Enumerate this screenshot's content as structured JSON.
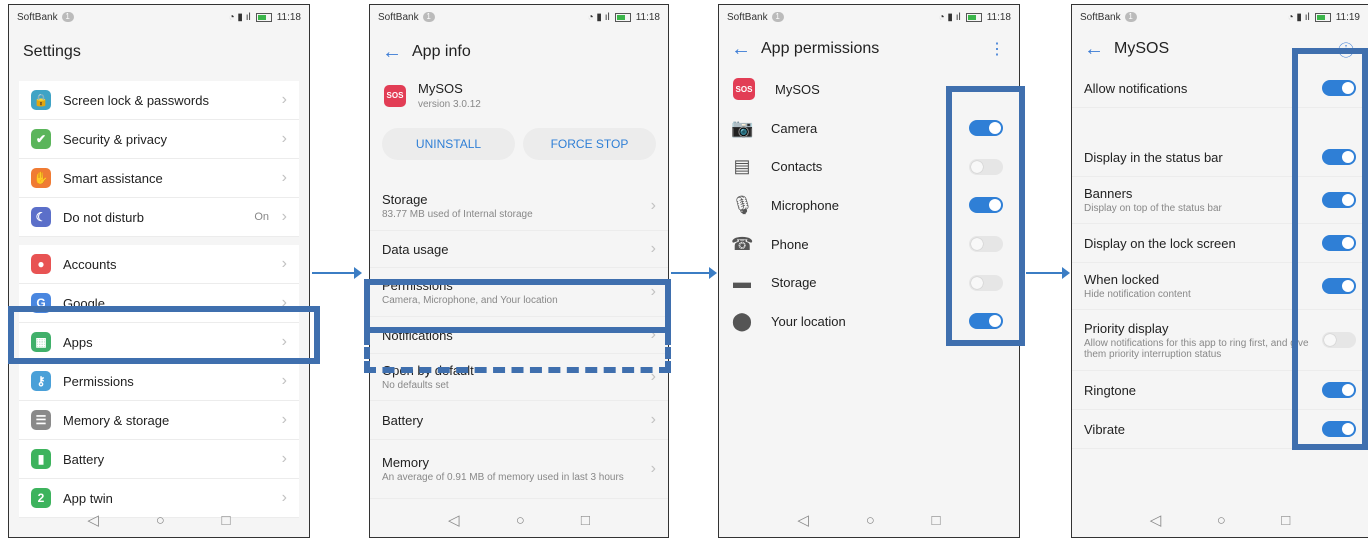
{
  "status": {
    "carrier": "SoftBank",
    "sim": "1",
    "time": "11:18",
    "time4": "11:19"
  },
  "screen1": {
    "title": "Settings",
    "items": [
      {
        "label": "Screen lock & passwords",
        "icon": "lock-icon",
        "color": "#3fa3c5"
      },
      {
        "label": "Security & privacy",
        "icon": "shield-icon",
        "color": "#5bb55b"
      },
      {
        "label": "Smart assistance",
        "icon": "hand-icon",
        "color": "#f07b33"
      },
      {
        "label": "Do not disturb",
        "icon": "moon-icon",
        "color": "#5b6fc9",
        "value": "On"
      },
      {
        "label": "Accounts",
        "icon": "person-icon",
        "color": "#e85353"
      },
      {
        "label": "Google",
        "icon": "google-icon",
        "color": "#4a87e0"
      },
      {
        "label": "Apps",
        "icon": "apps-icon",
        "color": "#40b06a"
      },
      {
        "label": "Permissions",
        "icon": "key-icon",
        "color": "#4aa0d8"
      },
      {
        "label": "Memory & storage",
        "icon": "storage-icon",
        "color": "#8a8a8a"
      },
      {
        "label": "Battery",
        "icon": "battery-icon",
        "color": "#3db35d"
      },
      {
        "label": "App twin",
        "icon": "twin-icon",
        "color": "#3db35d"
      }
    ]
  },
  "screen2": {
    "title": "App info",
    "app_name": "MySOS",
    "version": "version 3.0.12",
    "uninstall": "UNINSTALL",
    "force_stop": "FORCE STOP",
    "storage": {
      "label": "Storage",
      "sub": "83.77 MB used of Internal storage"
    },
    "data_usage": {
      "label": "Data usage"
    },
    "permissions": {
      "label": "Permissions",
      "sub": "Camera, Microphone, and Your location"
    },
    "notifications": {
      "label": "Notifications"
    },
    "open_default": {
      "label": "Open by default",
      "sub": "No defaults set"
    },
    "battery": {
      "label": "Battery"
    },
    "memory": {
      "label": "Memory",
      "sub": "An average of 0.91 MB of memory used in last 3 hours"
    }
  },
  "screen3": {
    "title": "App permissions",
    "app_name": "MySOS",
    "items": [
      {
        "label": "Camera",
        "icon": "camera-icon",
        "on": true
      },
      {
        "label": "Contacts",
        "icon": "contacts-icon",
        "on": false
      },
      {
        "label": "Microphone",
        "icon": "microphone-icon",
        "on": true
      },
      {
        "label": "Phone",
        "icon": "phone-icon",
        "on": false
      },
      {
        "label": "Storage",
        "icon": "folder-icon",
        "on": false
      },
      {
        "label": "Your location",
        "icon": "location-icon",
        "on": true
      }
    ]
  },
  "screen4": {
    "title": "MySOS",
    "items": [
      {
        "label": "Allow notifications",
        "on": true
      },
      {
        "label": "Display in the status bar",
        "on": true
      },
      {
        "label": "Banners",
        "sub": "Display on top of the status bar",
        "on": true
      },
      {
        "label": "Display on the lock screen",
        "on": true
      },
      {
        "label": "When locked",
        "sub": "Hide notification content",
        "on": true
      },
      {
        "label": "Priority display",
        "sub": "Allow notifications for this app to ring first, and give them priority interruption status",
        "on": false
      },
      {
        "label": "Ringtone",
        "on": true
      },
      {
        "label": "Vibrate",
        "on": true
      }
    ]
  },
  "nav": {
    "back": "◁",
    "home": "○",
    "recent": "□"
  },
  "colors": {
    "accent": "#2f7fd6",
    "highlight": "#3f6fae"
  }
}
